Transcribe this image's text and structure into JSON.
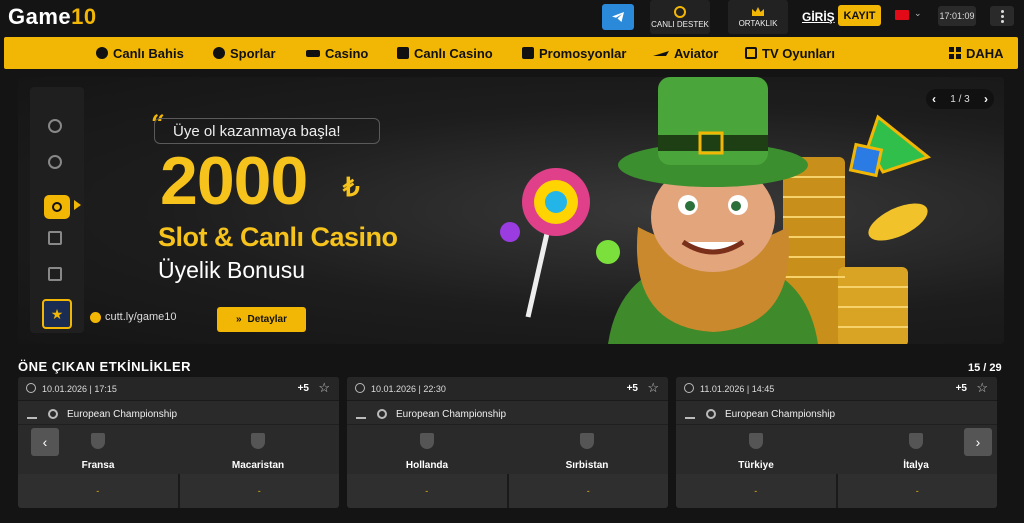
{
  "header": {
    "logo_text": "Game",
    "logo_num": "10",
    "live_support_label": "CANLI DESTEK",
    "affiliate_label": "ORTAKLIK",
    "login_label": "GİRİŞ",
    "register_label": "KAYIT",
    "time": "17:01:09",
    "language_flag": "tr-flag-icon"
  },
  "nav": {
    "items": [
      {
        "label": "Canlı Bahis",
        "icon": "play-circle-icon"
      },
      {
        "label": "Sporlar",
        "icon": "soccer-ball-icon"
      },
      {
        "label": "Casino",
        "icon": "slot-icon"
      },
      {
        "label": "Canlı Casino",
        "icon": "dealer-icon"
      },
      {
        "label": "Promosyonlar",
        "icon": "gift-icon"
      },
      {
        "label": "Aviator",
        "icon": "plane-icon"
      },
      {
        "label": "TV Oyunları",
        "icon": "tv-icon"
      }
    ],
    "more_label": "DAHA"
  },
  "banner": {
    "tagline": "Üye ol kazanmaya başla!",
    "amount": "2000",
    "currency": "₺",
    "line2": "Slot & Canlı Casino",
    "line3": "Üyelik Bonusu",
    "link": "cutt.ly/game10",
    "details_label": "Detaylar",
    "slide_indicator": "1 / 3"
  },
  "events": {
    "title": "ÖNE ÇIKAN ETKİNLİKLER",
    "page": "15 / 29",
    "cards": [
      {
        "date": "10.01.2026 | 17:15",
        "more": "+5",
        "league": "European Championship",
        "home": "Fransa",
        "away": "Macaristan",
        "odd1": "-",
        "odd2": "-"
      },
      {
        "date": "10.01.2026 | 22:30",
        "more": "+5",
        "league": "European Championship",
        "home": "Hollanda",
        "away": "Sırbistan",
        "odd1": "-",
        "odd2": "-"
      },
      {
        "date": "11.01.2026 | 14:45",
        "more": "+5",
        "league": "European Championship",
        "home": "Türkiye",
        "away": "İtalya",
        "odd1": "-",
        "odd2": "-"
      }
    ]
  },
  "colors": {
    "accent": "#f2b705",
    "background": "#141414",
    "card": "#2a2a2a",
    "telegram": "#2b89d9"
  }
}
